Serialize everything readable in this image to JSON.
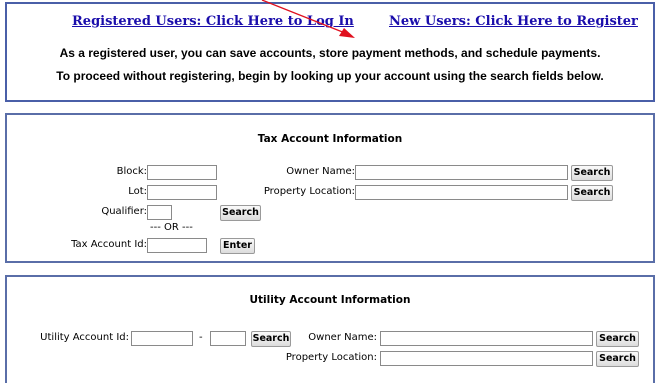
{
  "header": {
    "login_link": "Registered Users: Click Here to Log In",
    "register_link": "New Users: Click Here to Register",
    "message_line1": "As a registered user, you can save accounts, store payment methods, and schedule payments.",
    "message_line2": "To proceed without registering, begin by looking up your account using the search fields below."
  },
  "tax": {
    "title": "Tax Account Information",
    "block_label": "Block:",
    "lot_label": "Lot:",
    "qualifier_label": "Qualifier:",
    "or_text": "--- OR ---",
    "tax_id_label": "Tax Account Id:",
    "owner_label": "Owner Name:",
    "property_label": "Property Location:",
    "search_label": "Search",
    "enter_label": "Enter",
    "block_value": "",
    "lot_value": "",
    "qualifier_value": "",
    "tax_id_value": "",
    "owner_value": "",
    "property_value": ""
  },
  "utility": {
    "title": "Utility Account Information",
    "account_label": "Utility Account Id:",
    "dash": "-",
    "owner_label": "Owner Name:",
    "property_label": "Property Location:",
    "search_label": "Search",
    "account_value1": "",
    "account_value2": "",
    "owner_value": "",
    "property_value": ""
  },
  "colors": {
    "arrow": "#e0101e",
    "link": "#1a0dab",
    "border": "#4a5fa8"
  }
}
